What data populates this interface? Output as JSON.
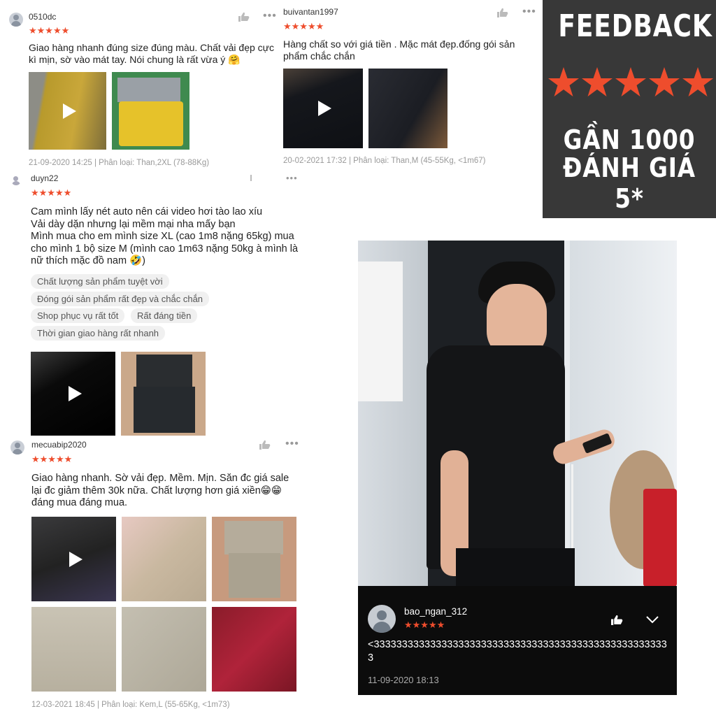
{
  "reviews": [
    {
      "username": "0510dc",
      "stars": "★★★★★",
      "comment": "Giao hàng nhanh đúng size đúng màu. Chất vải đẹp cực kì mịn, sờ vào mát tay. Nói chung là rất vừa ý 🤗",
      "meta": "21-09-2020 14:25 | Phân loại: Than,2XL (78-88Kg)"
    },
    {
      "username": "buivantan1997",
      "stars": "★★★★★",
      "comment": "Hàng chất so với giá tiền . Mặc mát đẹp.đống gói sản phẩm chắc chắn",
      "meta": "20-02-2021 17:32 | Phân loại: Than,M (45-55Kg, <1m67)"
    },
    {
      "username": "duyn22",
      "stars": "★★★★★",
      "comment": "Cam mình lấy nét auto nên cái video hơi tào lao xíu\nVải dày dặn nhưng lại mềm mại nha mấy bạn\nMình mua cho em mình size XL (cao 1m8 nặng 65kg) mua cho mình 1 bộ size M (mình cao 1m63 nặng 50kg à mình là nữ thích mặc đồ nam 🤣)",
      "tags": [
        "Chất lượng sản phẩm tuyệt vời",
        "Đóng gói sản phẩm rất đẹp và chắc chắn",
        "Shop phục vụ rất tốt",
        "Rất đáng tiền",
        "Thời gian giao hàng rất nhanh"
      ]
    },
    {
      "username": "mecuabip2020",
      "stars": "★★★★★",
      "comment": "Giao hàng nhanh. Sờ vải đẹp. Mềm. Mịn. Săn đc giá sale lại đc giảm thêm 30k nữa. Chất lượng hơn giá xiền😁😁 đáng mua đáng mua.",
      "meta": "12-03-2021 18:45 | Phân loại: Kem,L (55-65Kg, <1m73)"
    }
  ],
  "feedback": {
    "title": "FEEDBACK",
    "line1": "GẦN 1000",
    "line2": "ĐÁNH GIÁ 5*",
    "star_color": "#ee4d2d"
  },
  "photo_review": {
    "username": "bao_ngan_312",
    "stars": "★★★★★",
    "comment": "<33333333333333333333333333333333333333333333333333333",
    "date": "11-09-2020 18:13"
  },
  "colors": {
    "accent": "#ee4d2d",
    "panel": "#383838"
  }
}
